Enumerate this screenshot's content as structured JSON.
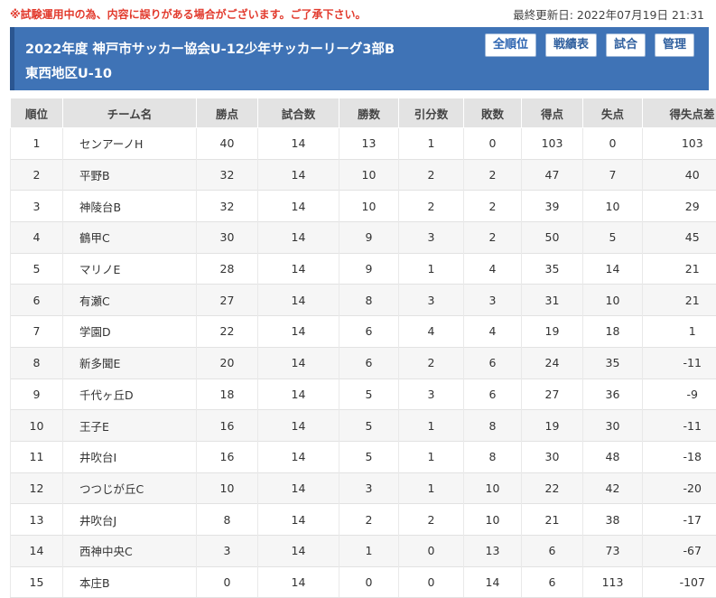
{
  "notice": "※試験運用中の為、内容に誤りがある場合がございます。ご了承下さい。",
  "updated": "最終更新日: 2022年07月19日 21:31",
  "header": {
    "title_line1": "2022年度 神戸市サッカー協会U-12少年サッカーリーグ3部B",
    "title_line2": "東西地区U-10",
    "buttons": [
      "全順位",
      "戦績表",
      "試合",
      "管理"
    ]
  },
  "table": {
    "headers": [
      "順位",
      "チーム名",
      "勝点",
      "試合数",
      "勝数",
      "引分数",
      "敗数",
      "得点",
      "失点",
      "得失点差"
    ],
    "rows": [
      [
        "1",
        "センアーノH",
        "40",
        "14",
        "13",
        "1",
        "0",
        "103",
        "0",
        "103"
      ],
      [
        "2",
        "平野B",
        "32",
        "14",
        "10",
        "2",
        "2",
        "47",
        "7",
        "40"
      ],
      [
        "3",
        "神陵台B",
        "32",
        "14",
        "10",
        "2",
        "2",
        "39",
        "10",
        "29"
      ],
      [
        "4",
        "鶴甲C",
        "30",
        "14",
        "9",
        "3",
        "2",
        "50",
        "5",
        "45"
      ],
      [
        "5",
        "マリノE",
        "28",
        "14",
        "9",
        "1",
        "4",
        "35",
        "14",
        "21"
      ],
      [
        "6",
        "有瀬C",
        "27",
        "14",
        "8",
        "3",
        "3",
        "31",
        "10",
        "21"
      ],
      [
        "7",
        "学園D",
        "22",
        "14",
        "6",
        "4",
        "4",
        "19",
        "18",
        "1"
      ],
      [
        "8",
        "新多聞E",
        "20",
        "14",
        "6",
        "2",
        "6",
        "24",
        "35",
        "-11"
      ],
      [
        "9",
        "千代ヶ丘D",
        "18",
        "14",
        "5",
        "3",
        "6",
        "27",
        "36",
        "-9"
      ],
      [
        "10",
        "王子E",
        "16",
        "14",
        "5",
        "1",
        "8",
        "19",
        "30",
        "-11"
      ],
      [
        "11",
        "井吹台I",
        "16",
        "14",
        "5",
        "1",
        "8",
        "30",
        "48",
        "-18"
      ],
      [
        "12",
        "つつじが丘C",
        "10",
        "14",
        "3",
        "1",
        "10",
        "22",
        "42",
        "-20"
      ],
      [
        "13",
        "井吹台J",
        "8",
        "14",
        "2",
        "2",
        "10",
        "21",
        "38",
        "-17"
      ],
      [
        "14",
        "西神中央C",
        "3",
        "14",
        "1",
        "0",
        "13",
        "6",
        "73",
        "-67"
      ],
      [
        "15",
        "本庄B",
        "0",
        "14",
        "0",
        "0",
        "14",
        "6",
        "113",
        "-107"
      ]
    ]
  },
  "colors": {
    "header_bg": "#3f73b6",
    "notice": "#e23b2e",
    "table_header_bg": "#e3e3e3"
  }
}
